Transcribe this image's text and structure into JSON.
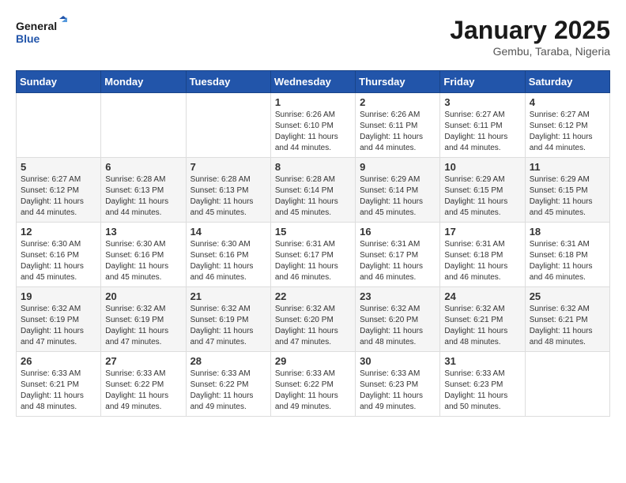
{
  "header": {
    "logo_line1": "General",
    "logo_line2": "Blue",
    "month": "January 2025",
    "location": "Gembu, Taraba, Nigeria"
  },
  "weekdays": [
    "Sunday",
    "Monday",
    "Tuesday",
    "Wednesday",
    "Thursday",
    "Friday",
    "Saturday"
  ],
  "weeks": [
    [
      {
        "day": "",
        "info": ""
      },
      {
        "day": "",
        "info": ""
      },
      {
        "day": "",
        "info": ""
      },
      {
        "day": "1",
        "info": "Sunrise: 6:26 AM\nSunset: 6:10 PM\nDaylight: 11 hours and 44 minutes."
      },
      {
        "day": "2",
        "info": "Sunrise: 6:26 AM\nSunset: 6:11 PM\nDaylight: 11 hours and 44 minutes."
      },
      {
        "day": "3",
        "info": "Sunrise: 6:27 AM\nSunset: 6:11 PM\nDaylight: 11 hours and 44 minutes."
      },
      {
        "day": "4",
        "info": "Sunrise: 6:27 AM\nSunset: 6:12 PM\nDaylight: 11 hours and 44 minutes."
      }
    ],
    [
      {
        "day": "5",
        "info": "Sunrise: 6:27 AM\nSunset: 6:12 PM\nDaylight: 11 hours and 44 minutes."
      },
      {
        "day": "6",
        "info": "Sunrise: 6:28 AM\nSunset: 6:13 PM\nDaylight: 11 hours and 44 minutes."
      },
      {
        "day": "7",
        "info": "Sunrise: 6:28 AM\nSunset: 6:13 PM\nDaylight: 11 hours and 45 minutes."
      },
      {
        "day": "8",
        "info": "Sunrise: 6:28 AM\nSunset: 6:14 PM\nDaylight: 11 hours and 45 minutes."
      },
      {
        "day": "9",
        "info": "Sunrise: 6:29 AM\nSunset: 6:14 PM\nDaylight: 11 hours and 45 minutes."
      },
      {
        "day": "10",
        "info": "Sunrise: 6:29 AM\nSunset: 6:15 PM\nDaylight: 11 hours and 45 minutes."
      },
      {
        "day": "11",
        "info": "Sunrise: 6:29 AM\nSunset: 6:15 PM\nDaylight: 11 hours and 45 minutes."
      }
    ],
    [
      {
        "day": "12",
        "info": "Sunrise: 6:30 AM\nSunset: 6:16 PM\nDaylight: 11 hours and 45 minutes."
      },
      {
        "day": "13",
        "info": "Sunrise: 6:30 AM\nSunset: 6:16 PM\nDaylight: 11 hours and 45 minutes."
      },
      {
        "day": "14",
        "info": "Sunrise: 6:30 AM\nSunset: 6:16 PM\nDaylight: 11 hours and 46 minutes."
      },
      {
        "day": "15",
        "info": "Sunrise: 6:31 AM\nSunset: 6:17 PM\nDaylight: 11 hours and 46 minutes."
      },
      {
        "day": "16",
        "info": "Sunrise: 6:31 AM\nSunset: 6:17 PM\nDaylight: 11 hours and 46 minutes."
      },
      {
        "day": "17",
        "info": "Sunrise: 6:31 AM\nSunset: 6:18 PM\nDaylight: 11 hours and 46 minutes."
      },
      {
        "day": "18",
        "info": "Sunrise: 6:31 AM\nSunset: 6:18 PM\nDaylight: 11 hours and 46 minutes."
      }
    ],
    [
      {
        "day": "19",
        "info": "Sunrise: 6:32 AM\nSunset: 6:19 PM\nDaylight: 11 hours and 47 minutes."
      },
      {
        "day": "20",
        "info": "Sunrise: 6:32 AM\nSunset: 6:19 PM\nDaylight: 11 hours and 47 minutes."
      },
      {
        "day": "21",
        "info": "Sunrise: 6:32 AM\nSunset: 6:19 PM\nDaylight: 11 hours and 47 minutes."
      },
      {
        "day": "22",
        "info": "Sunrise: 6:32 AM\nSunset: 6:20 PM\nDaylight: 11 hours and 47 minutes."
      },
      {
        "day": "23",
        "info": "Sunrise: 6:32 AM\nSunset: 6:20 PM\nDaylight: 11 hours and 48 minutes."
      },
      {
        "day": "24",
        "info": "Sunrise: 6:32 AM\nSunset: 6:21 PM\nDaylight: 11 hours and 48 minutes."
      },
      {
        "day": "25",
        "info": "Sunrise: 6:32 AM\nSunset: 6:21 PM\nDaylight: 11 hours and 48 minutes."
      }
    ],
    [
      {
        "day": "26",
        "info": "Sunrise: 6:33 AM\nSunset: 6:21 PM\nDaylight: 11 hours and 48 minutes."
      },
      {
        "day": "27",
        "info": "Sunrise: 6:33 AM\nSunset: 6:22 PM\nDaylight: 11 hours and 49 minutes."
      },
      {
        "day": "28",
        "info": "Sunrise: 6:33 AM\nSunset: 6:22 PM\nDaylight: 11 hours and 49 minutes."
      },
      {
        "day": "29",
        "info": "Sunrise: 6:33 AM\nSunset: 6:22 PM\nDaylight: 11 hours and 49 minutes."
      },
      {
        "day": "30",
        "info": "Sunrise: 6:33 AM\nSunset: 6:23 PM\nDaylight: 11 hours and 49 minutes."
      },
      {
        "day": "31",
        "info": "Sunrise: 6:33 AM\nSunset: 6:23 PM\nDaylight: 11 hours and 50 minutes."
      },
      {
        "day": "",
        "info": ""
      }
    ]
  ]
}
